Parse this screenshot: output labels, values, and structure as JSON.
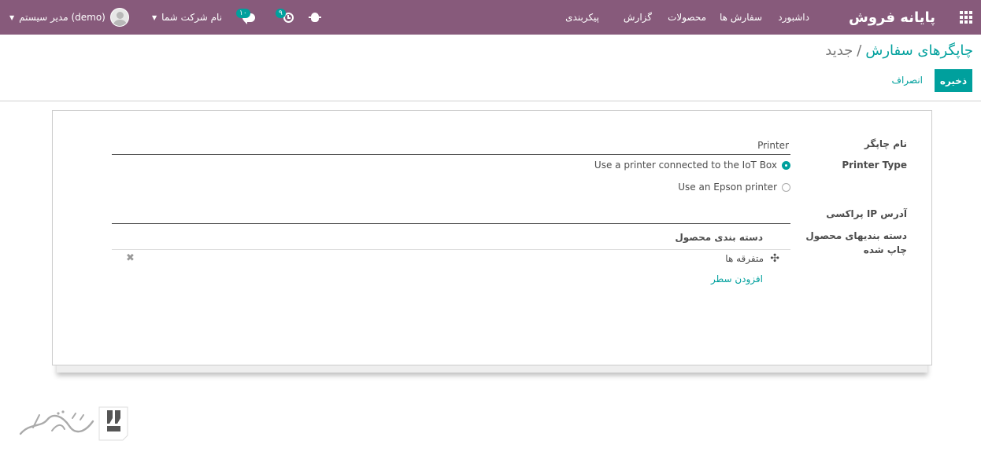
{
  "navbar": {
    "brand": "پایانه فروش",
    "menu": [
      "داشبورد",
      "سفارش ها",
      "محصولات",
      "گزارش",
      "پیکربندی"
    ],
    "messages_badge": "۱۰",
    "activities_badge": "۹",
    "company": "نام شرکت شما",
    "user": "مدیر سیستم (demo)"
  },
  "breadcrumb": {
    "parent": "چاپگرهای سفارش",
    "separator": "/",
    "current": "جدید"
  },
  "buttons": {
    "save": "ذخیره",
    "discard": "انصراف"
  },
  "form": {
    "name_label": "نام چاپگر",
    "name_value": "Printer",
    "type_label": "Printer Type",
    "type_options": [
      {
        "label": "Use a printer connected to the IoT Box",
        "selected": true
      },
      {
        "label": "Use an Epson printer",
        "selected": false
      }
    ],
    "ip_label": "آدرس IP پراکسی",
    "ip_value": "",
    "categories_label_line1": "دسته بندیهای محصول",
    "categories_label_line2": "چاپ شده",
    "categories_column": "دسته بندی محصول",
    "categories": [
      "متفرقه ها"
    ],
    "add_line": "افزودن سطر"
  },
  "colors": {
    "navbar": "#875a7b",
    "accent": "#00a09d"
  }
}
